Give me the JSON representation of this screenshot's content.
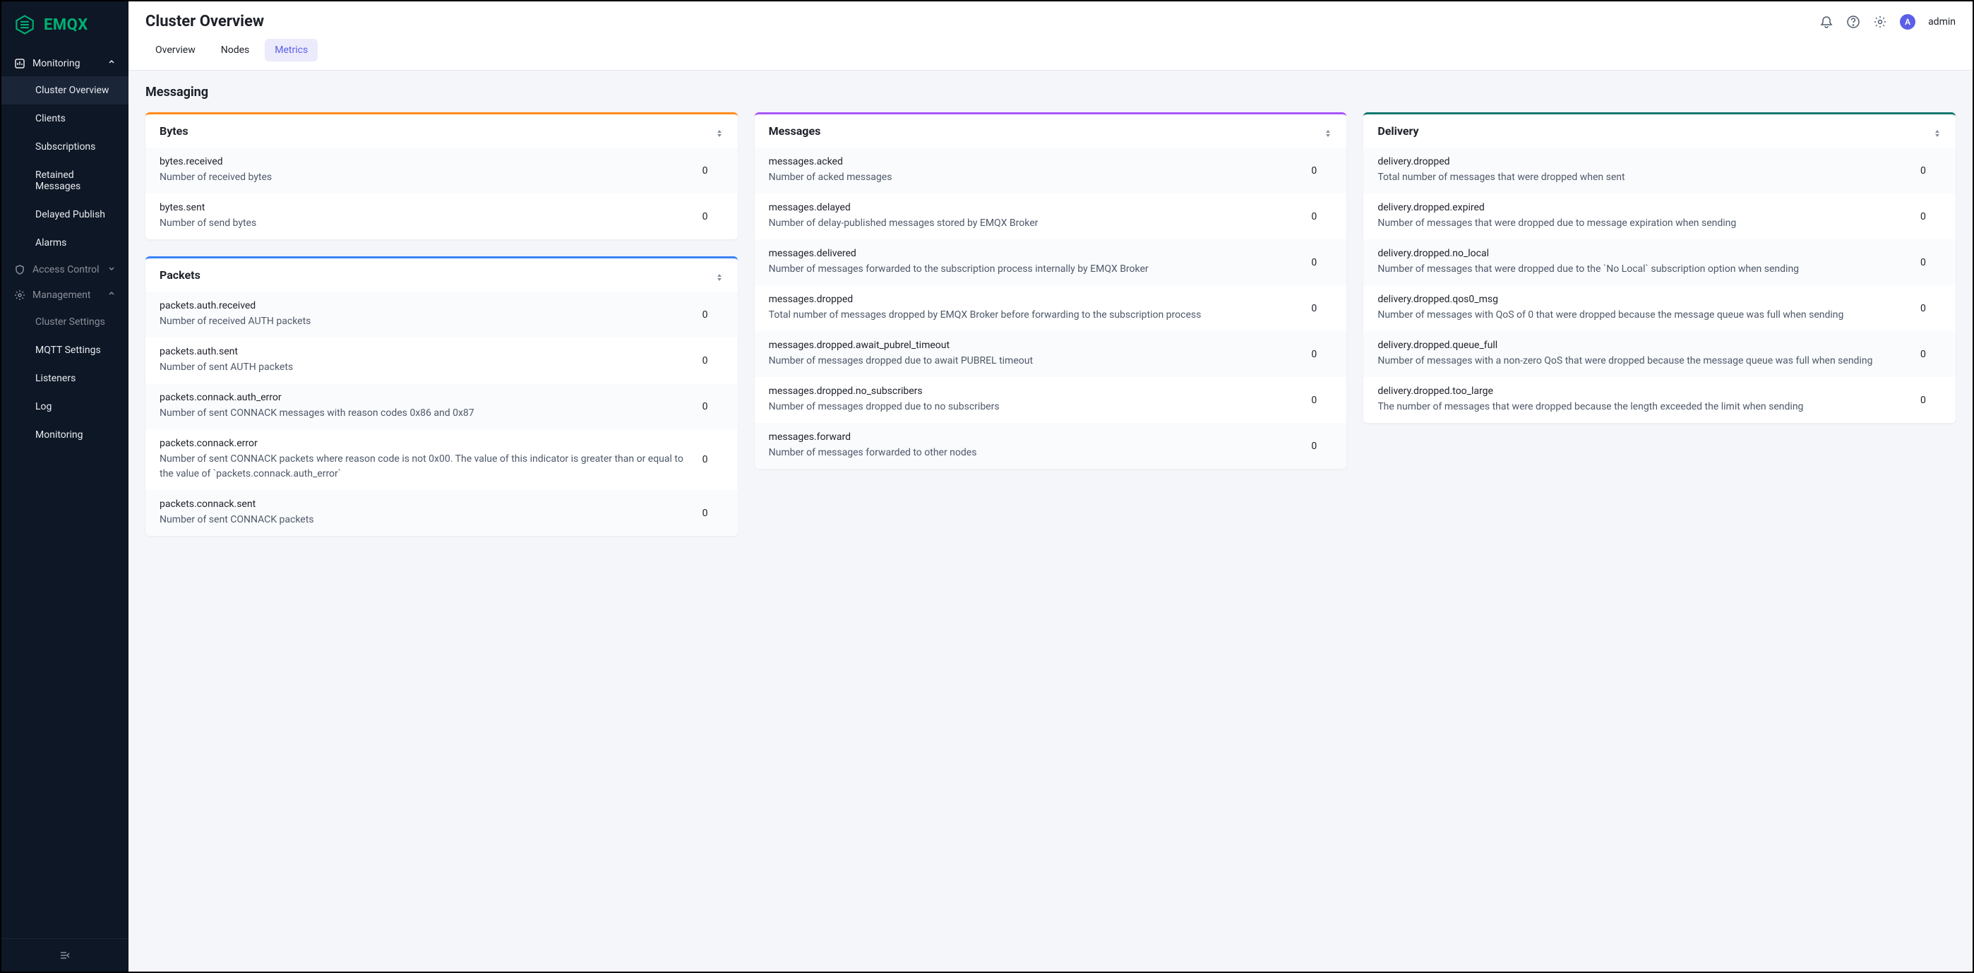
{
  "brand": "EMQX",
  "page_title": "Cluster Overview",
  "user": {
    "initial": "A",
    "name": "admin"
  },
  "tabs": [
    {
      "label": "Overview",
      "active": false
    },
    {
      "label": "Nodes",
      "active": false
    },
    {
      "label": "Metrics",
      "active": true
    }
  ],
  "sidebar": {
    "monitoring": {
      "label": "Monitoring",
      "items": [
        {
          "label": "Cluster Overview",
          "active": true
        },
        {
          "label": "Clients"
        },
        {
          "label": "Subscriptions"
        },
        {
          "label": "Retained Messages"
        },
        {
          "label": "Delayed Publish"
        },
        {
          "label": "Alarms"
        }
      ]
    },
    "access_control": {
      "label": "Access Control"
    },
    "management": {
      "label": "Management",
      "items": [
        {
          "label": "Cluster Settings"
        },
        {
          "label": "MQTT Settings",
          "light": true
        },
        {
          "label": "Listeners",
          "light": true
        },
        {
          "label": "Log",
          "light": true
        },
        {
          "label": "Monitoring",
          "light": true
        }
      ]
    }
  },
  "section_title": "Messaging",
  "cards": {
    "bytes": {
      "title": "Bytes",
      "rows": [
        {
          "name": "bytes.received",
          "desc": "Number of received bytes",
          "value": "0"
        },
        {
          "name": "bytes.sent",
          "desc": "Number of send bytes",
          "value": "0"
        }
      ]
    },
    "packets": {
      "title": "Packets",
      "rows": [
        {
          "name": "packets.auth.received",
          "desc": "Number of received AUTH packets",
          "value": "0"
        },
        {
          "name": "packets.auth.sent",
          "desc": "Number of sent AUTH packets",
          "value": "0"
        },
        {
          "name": "packets.connack.auth_error",
          "desc": "Number of sent CONNACK messages with reason codes 0x86 and 0x87",
          "value": "0"
        },
        {
          "name": "packets.connack.error",
          "desc": "Number of sent CONNACK packets where reason code is not 0x00. The value of this indicator is greater than or equal to the value of `packets.connack.auth_error`",
          "value": "0"
        },
        {
          "name": "packets.connack.sent",
          "desc": "Number of sent CONNACK packets",
          "value": "0"
        }
      ]
    },
    "messages": {
      "title": "Messages",
      "rows": [
        {
          "name": "messages.acked",
          "desc": "Number of acked messages",
          "value": "0"
        },
        {
          "name": "messages.delayed",
          "desc": "Number of delay-published messages stored by EMQX Broker",
          "value": "0"
        },
        {
          "name": "messages.delivered",
          "desc": "Number of messages forwarded to the subscription process internally by EMQX Broker",
          "value": "0"
        },
        {
          "name": "messages.dropped",
          "desc": "Total number of messages dropped by EMQX Broker before forwarding to the subscription process",
          "value": "0"
        },
        {
          "name": "messages.dropped.await_pubrel_timeout",
          "desc": "Number of messages dropped due to await PUBREL timeout",
          "value": "0"
        },
        {
          "name": "messages.dropped.no_subscribers",
          "desc": "Number of messages dropped due to no subscribers",
          "value": "0"
        },
        {
          "name": "messages.forward",
          "desc": "Number of messages forwarded to other nodes",
          "value": "0"
        }
      ]
    },
    "delivery": {
      "title": "Delivery",
      "rows": [
        {
          "name": "delivery.dropped",
          "desc": "Total number of messages that were dropped when sent",
          "value": "0"
        },
        {
          "name": "delivery.dropped.expired",
          "desc": "Number of messages that were dropped due to message expiration when sending",
          "value": "0"
        },
        {
          "name": "delivery.dropped.no_local",
          "desc": "Number of messages that were dropped due to the `No Local` subscription option when sending",
          "value": "0"
        },
        {
          "name": "delivery.dropped.qos0_msg",
          "desc": "Number of messages with QoS of 0 that were dropped because the message queue was full when sending",
          "value": "0"
        },
        {
          "name": "delivery.dropped.queue_full",
          "desc": "Number of messages with a non-zero QoS that were dropped because the message queue was full when sending",
          "value": "0"
        },
        {
          "name": "delivery.dropped.too_large",
          "desc": "The number of messages that were dropped because the length exceeded the limit when sending",
          "value": "0"
        }
      ]
    }
  }
}
